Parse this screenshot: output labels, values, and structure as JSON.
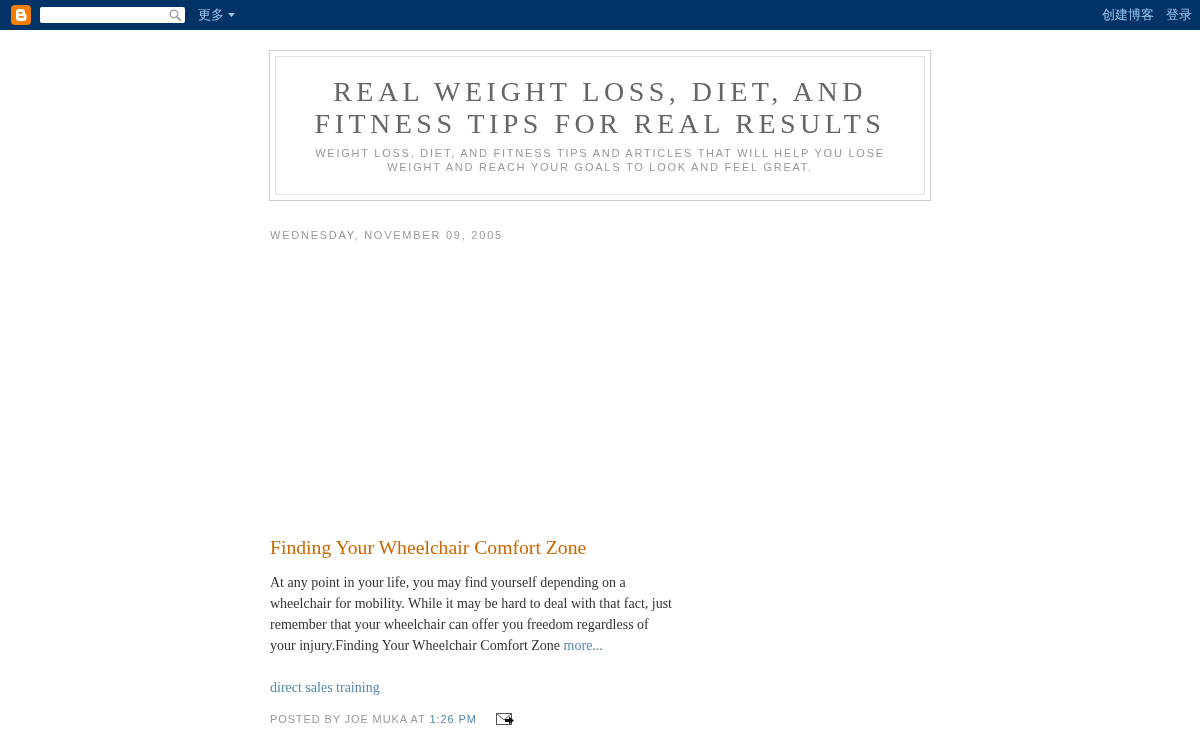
{
  "navbar": {
    "menu_label": "更多",
    "links": [
      "创建博客",
      "登录"
    ]
  },
  "header": {
    "title": "REAL WEIGHT LOSS, DIET, AND FITNESS TIPS FOR REAL RESULTS",
    "description": "WEIGHT LOSS, DIET, AND FITNESS TIPS AND ARTICLES THAT WILL HELP YOU LOSE WEIGHT AND REACH YOUR GOALS TO LOOK AND FEEL GREAT."
  },
  "date_header": "WEDNESDAY, NOVEMBER 09, 2005",
  "post": {
    "title": "Finding Your Wheelchair Comfort Zone",
    "body": "At any point in your life, you may find yourself depending on a wheelchair for mobility. While it may be hard to deal with that fact, just remember that your wheelchair can offer you freedom regardless of your injury.Finding Your Wheelchair Comfort Zone",
    "more_link": "more...",
    "links": [
      "direct sales training"
    ],
    "byline": "POSTED BY JOE MUKA AT",
    "time": "1:26 PM"
  }
}
